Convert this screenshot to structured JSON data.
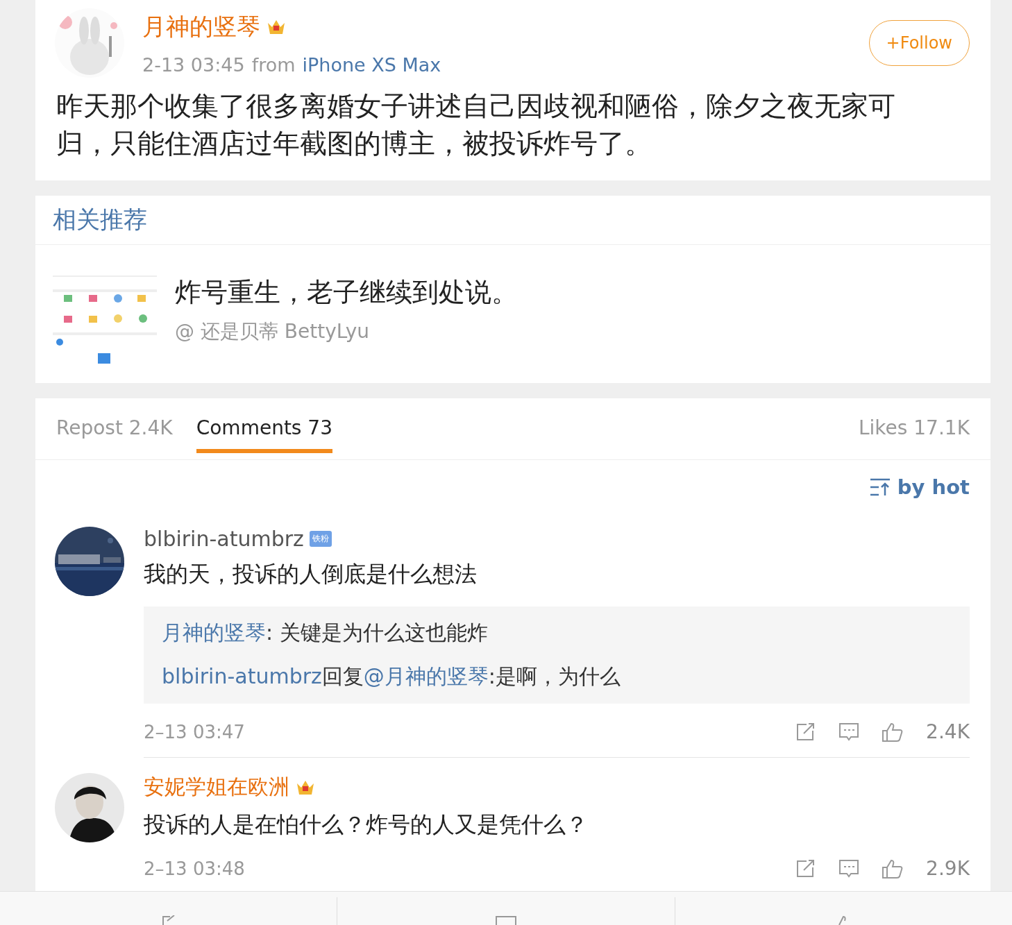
{
  "post": {
    "author": "月神的竖琴",
    "time": "2-13 03:45",
    "from_label": "from",
    "source": "iPhone XS Max",
    "follow": "+Follow",
    "text": "昨天那个收集了很多离婚女子讲述自己因歧视和陋俗，除夕之夜无家可归，只能住酒店过年截图的博主，被投诉炸号了。"
  },
  "related": {
    "title": "相关推荐",
    "item": {
      "kind": "picture",
      "headline": "炸号重生，老子继续到处说。",
      "author": "@ 还是贝蒂 BettyLyu"
    }
  },
  "tabs": [
    {
      "label": "Repost 2.4K",
      "selected": false
    },
    {
      "label": "Comments 73",
      "selected": true
    }
  ],
  "likes": "Likes 17.1K",
  "sort": "by hot",
  "comments": [
    {
      "name": "blbirin-atumbrz",
      "vip": false,
      "badge": "铁粉",
      "text": "我的天，投诉的人倒底是什么想法",
      "replies": [
        {
          "user": "月神的竖琴",
          "sep": ":",
          "text": " 关键是为什么这也能炸"
        },
        {
          "user": "blbirin-atumbrz",
          "mid": "回复",
          "mention": "@月神的竖琴",
          "sep": ":",
          "text": "是啊，为什么"
        }
      ],
      "time": "2–13 03:47",
      "likes": "2.4K"
    },
    {
      "name": "安妮学姐在欧洲",
      "vip": true,
      "text": "投诉的人是在怕什么？炸号的人又是凭什么？",
      "time": "2–13 03:48",
      "likes": "2.9K"
    }
  ]
}
